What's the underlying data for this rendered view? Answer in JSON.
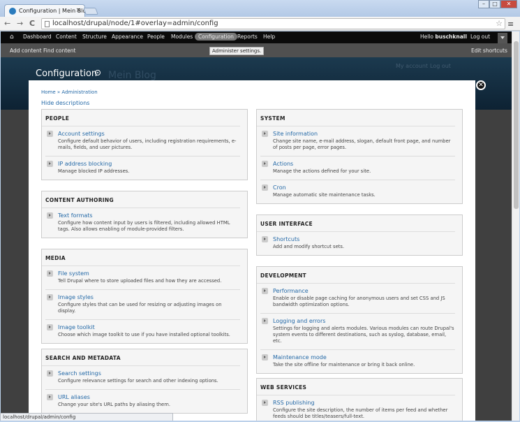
{
  "browser": {
    "tab_title": "Configuration | Mein Blog",
    "tab_close": "×",
    "url": "localhost/drupal/node/1#overlay=admin/config",
    "back": "←",
    "forward": "→",
    "reload": "C",
    "star": "☆",
    "menu": "≡",
    "win_min": "–",
    "win_max": "□",
    "win_close": "✕",
    "status": "localhost/drupal/admin/config"
  },
  "toolbar": {
    "items": [
      "Dashboard",
      "Content",
      "Structure",
      "Appearance",
      "People",
      "Modules",
      "Configuration",
      "Reports",
      "Help"
    ],
    "hello_prefix": "Hello ",
    "user": "buschknall",
    "logout": "Log out",
    "tooltip": "Administer settings."
  },
  "shortcuts": {
    "add_content": "Add content",
    "find_content": "Find content",
    "edit_shortcuts": "Edit shortcuts"
  },
  "header": {
    "site_name": "Mein Blog",
    "my_account": "My account",
    "log_out": "Log out",
    "overlay_title": "Configuration"
  },
  "overlay": {
    "breadcrumb": "Home » Administration",
    "hide_descriptions": "Hide descriptions",
    "close": "✕"
  },
  "panels": {
    "people": {
      "title": "PEOPLE",
      "entries": [
        {
          "title": "Account settings",
          "desc": "Configure default behavior of users, including registration requirements, e-mails, fields, and user pictures."
        },
        {
          "title": "IP address blocking",
          "desc": "Manage blocked IP addresses."
        }
      ]
    },
    "content_authoring": {
      "title": "CONTENT AUTHORING",
      "entries": [
        {
          "title": "Text formats",
          "desc": "Configure how content input by users is filtered, including allowed HTML tags. Also allows enabling of module-provided filters."
        }
      ]
    },
    "media": {
      "title": "MEDIA",
      "entries": [
        {
          "title": "File system",
          "desc": "Tell Drupal where to store uploaded files and how they are accessed."
        },
        {
          "title": "Image styles",
          "desc": "Configure styles that can be used for resizing or adjusting images on display."
        },
        {
          "title": "Image toolkit",
          "desc": "Choose which image toolkit to use if you have installed optional toolkits."
        }
      ]
    },
    "search": {
      "title": "SEARCH AND METADATA",
      "entries": [
        {
          "title": "Search settings",
          "desc": "Configure relevance settings for search and other indexing options."
        },
        {
          "title": "URL aliases",
          "desc": "Change your site's URL paths by aliasing them."
        }
      ]
    },
    "system": {
      "title": "SYSTEM",
      "entries": [
        {
          "title": "Site information",
          "desc": "Change site name, e-mail address, slogan, default front page, and number of posts per page, error pages."
        },
        {
          "title": "Actions",
          "desc": "Manage the actions defined for your site."
        },
        {
          "title": "Cron",
          "desc": "Manage automatic site maintenance tasks."
        }
      ]
    },
    "user_interface": {
      "title": "USER INTERFACE",
      "entries": [
        {
          "title": "Shortcuts",
          "desc": "Add and modify shortcut sets."
        }
      ]
    },
    "development": {
      "title": "DEVELOPMENT",
      "entries": [
        {
          "title": "Performance",
          "desc": "Enable or disable page caching for anonymous users and set CSS and JS bandwidth optimization options."
        },
        {
          "title": "Logging and errors",
          "desc": "Settings for logging and alerts modules. Various modules can route Drupal's system events to different destinations, such as syslog, database, email, etc."
        },
        {
          "title": "Maintenance mode",
          "desc": "Take the site offline for maintenance or bring it back online."
        }
      ]
    },
    "web_services": {
      "title": "WEB SERVICES",
      "entries": [
        {
          "title": "RSS publishing",
          "desc": "Configure the site description, the number of items per feed and whether feeds should be titles/teasers/full-text."
        }
      ]
    }
  }
}
